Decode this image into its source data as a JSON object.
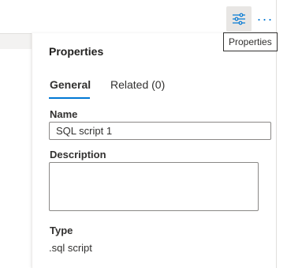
{
  "toolbar": {
    "properties_icon": "sliders-icon",
    "more_icon": "more-icon",
    "more_label": "···"
  },
  "tooltip": {
    "text": "Properties"
  },
  "panel": {
    "title": "Properties",
    "tabs": [
      {
        "label": "General",
        "active": true
      },
      {
        "label": "Related (0)",
        "active": false
      }
    ],
    "fields": {
      "name": {
        "label": "Name",
        "value": "SQL script 1"
      },
      "description": {
        "label": "Description",
        "value": ""
      },
      "type": {
        "label": "Type",
        "value": ".sql script"
      }
    }
  },
  "colors": {
    "accent": "#0078d4",
    "text": "#323130",
    "border": "#8a8886"
  }
}
